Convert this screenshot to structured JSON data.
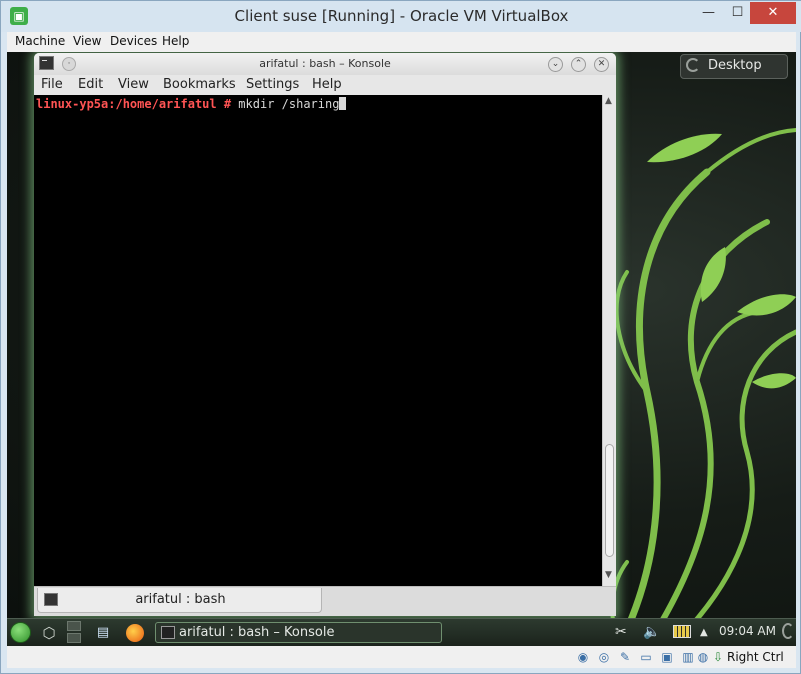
{
  "host": {
    "title": "Client suse [Running] - Oracle VM VirtualBox",
    "menu": [
      "Machine",
      "View",
      "Devices",
      "Help"
    ],
    "controls": {
      "minimize": "—",
      "maximize": "☐",
      "close": "✕"
    },
    "status_host_key": "Right Ctrl"
  },
  "desktop": {
    "widget_label": "Desktop"
  },
  "konsole": {
    "title": "arifatul : bash – Konsole",
    "menu": [
      "File",
      "Edit",
      "View",
      "Bookmarks",
      "Settings",
      "Help"
    ],
    "prompt": "linux-yp5a:/home/arifatul # ",
    "command": "mkdir /sharing",
    "tab_label": "arifatul : bash"
  },
  "panel": {
    "task_label": "arifatul : bash – Konsole",
    "clock": "09:04 AM"
  },
  "icons": {
    "host_app": "virtualbox-icon",
    "widget": "cashew-icon",
    "panel_menu": "opensuse-menu-icon",
    "activities": "activities-icon",
    "file_manager": "file-manager-icon",
    "browser": "firefox-icon",
    "tray": [
      "scissors-icon",
      "speaker-icon",
      "battery-icon",
      "tray-expand-icon"
    ]
  },
  "colors": {
    "prompt": "#ff5454",
    "terminal_bg": "#000000",
    "host_close": "#c7463d",
    "glow": "#8cd28c"
  }
}
